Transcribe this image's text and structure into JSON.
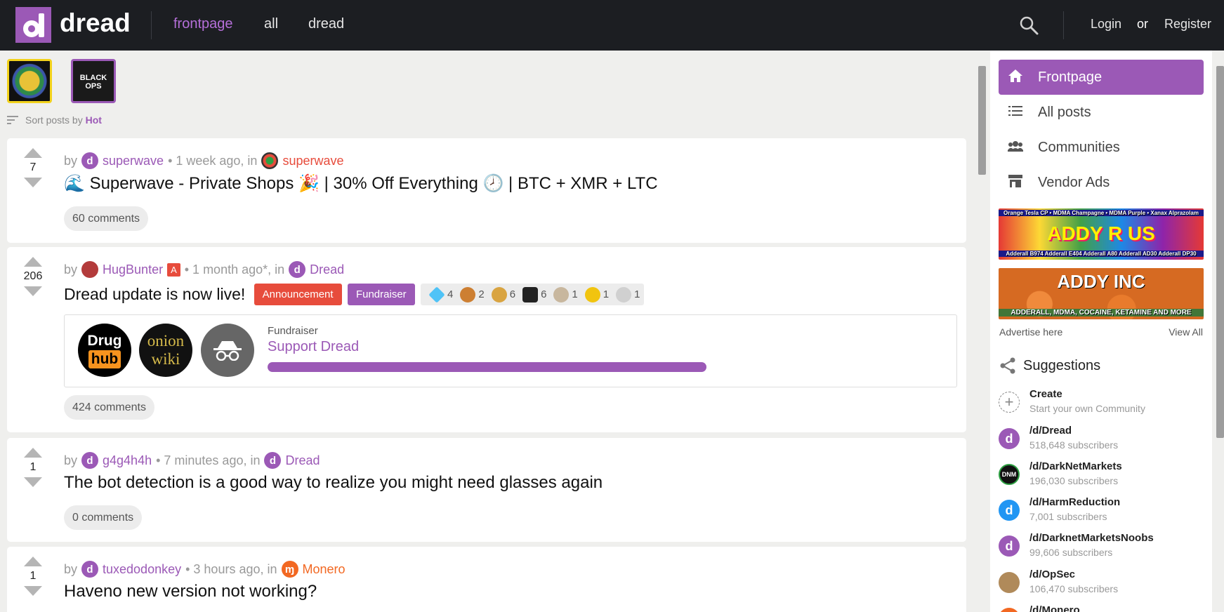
{
  "header": {
    "logo_text": "dread",
    "nav": [
      "frontpage",
      "all",
      "dread"
    ],
    "login": "Login",
    "or": "or",
    "register": "Register"
  },
  "thumbs": {
    "second_label": "BLACK OPS"
  },
  "sort": {
    "prefix": "Sort posts by",
    "value": "Hot"
  },
  "posts": [
    {
      "votes": "7",
      "by": "by",
      "user": "superwave",
      "meta": "• 1 week ago, in",
      "sub": "superwave",
      "title": "Superwave - Private Shops 🎉 | 30% Off Everything 🕗 | BTC + XMR + LTC",
      "comments": "60 comments"
    },
    {
      "votes": "206",
      "by": "by",
      "user": "HugBunter",
      "admin_badge": "A",
      "meta": "• 1 month ago*, in",
      "sub": "Dread",
      "title": "Dread update is now live!",
      "tags": [
        "Announcement",
        "Fundraiser"
      ],
      "awards": [
        "4",
        "2",
        "6",
        "6",
        "1",
        "1",
        "1"
      ],
      "fundraiser": {
        "label": "Fundraiser",
        "title": "Support Dread",
        "progress": 1.0,
        "logo1_top": "Drug",
        "logo1_bottom": "hub",
        "logo2_top": "onion",
        "logo2_bottom": "wiki"
      },
      "comments": "424 comments"
    },
    {
      "votes": "1",
      "by": "by",
      "user": "g4g4h4h",
      "meta": "• 7 minutes ago, in",
      "sub": "Dread",
      "title": "The bot detection is a good way to realize you might need glasses again",
      "comments": "0 comments"
    },
    {
      "votes": "1",
      "by": "by",
      "user": "tuxedodonkey",
      "meta": "• 3 hours ago, in",
      "sub": "Monero",
      "title": "Haveno new version not working?"
    }
  ],
  "sidebar": {
    "nav": [
      "Frontpage",
      "All posts",
      "Communities",
      "Vendor Ads"
    ],
    "ad1_top": "Orange Tesla CP • MDMA Champagne • MDMA Purple • Xanax Alprazolam",
    "ad1_main": "ADDY R US",
    "ad1_bottom": "Adderall B974 Adderall E404 Adderall A80 Adderall AD30 Adderall DP30",
    "ad2_main": "ADDY INC",
    "ad2_bottom": "ADDERALL, MDMA, COCAINE, KETAMINE AND MORE",
    "advertise": "Advertise here",
    "view_all": "View All",
    "suggestions": "Suggestions",
    "create_title": "Create",
    "create_sub": "Start your own Community",
    "communities": [
      {
        "name": "/d/Dread",
        "subs": "518,648 subscribers"
      },
      {
        "name": "/d/DarkNetMarkets",
        "subs": "196,030 subscribers"
      },
      {
        "name": "/d/HarmReduction",
        "subs": "7,001 subscribers"
      },
      {
        "name": "/d/DarknetMarketsNoobs",
        "subs": "99,606 subscribers"
      },
      {
        "name": "/d/OpSec",
        "subs": "106,470 subscribers"
      },
      {
        "name": "/d/Monero",
        "subs": ""
      }
    ]
  },
  "colors": {
    "accent": "#9b59b6",
    "header_bg": "#1c1e22",
    "announcement": "#e74c3c",
    "monero": "#f26822"
  }
}
